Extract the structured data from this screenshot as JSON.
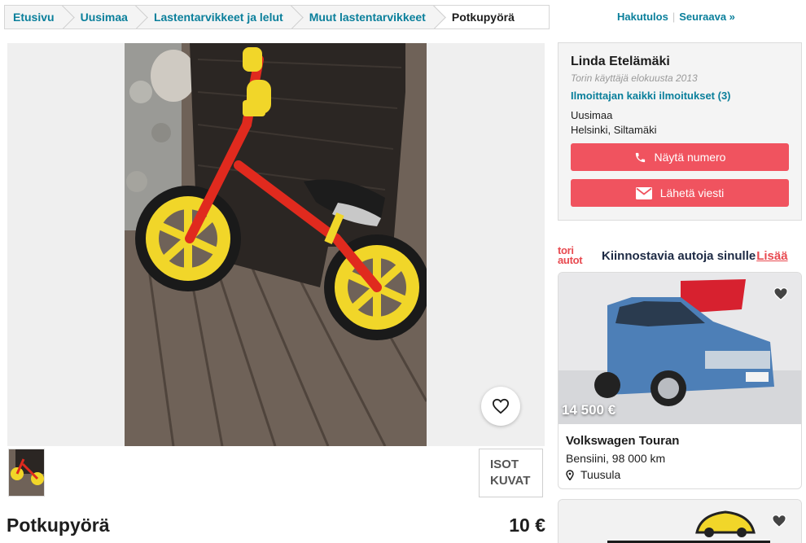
{
  "breadcrumb": {
    "items": [
      "Etusivu",
      "Uusimaa",
      "Lastentarvikkeet ja lelut",
      "Muut lastentarvikkeet"
    ],
    "current": "Potkupyörä"
  },
  "topnav": {
    "results": "Hakutulos",
    "next": "Seuraava »"
  },
  "gallery": {
    "fullsize_label_line1": "ISOT",
    "fullsize_label_line2": "KUVAT",
    "favorite_icon": "heart-outline-icon"
  },
  "listing": {
    "title": "Potkupyörä",
    "price": "10 €"
  },
  "seller": {
    "name": "Linda Etelämäki",
    "since": "Torin käyttäjä elokuusta 2013",
    "all_listings_link": "Ilmoittajan kaikki ilmoitukset (3)",
    "region": "Uusimaa",
    "city": "Helsinki, Siltamäki",
    "show_number": "Näytä numero",
    "send_message": "Lähetä viesti"
  },
  "promo": {
    "logo_line1": "tori",
    "logo_line2": "autot",
    "title": "Kiinnostavia autoja sinulle",
    "more": "Lisää",
    "cars": [
      {
        "price": "14 500 €",
        "name": "Volkswagen Touran",
        "specs": "Bensiini, 98 000 km",
        "location": "Tuusula"
      }
    ]
  },
  "colors": {
    "accent": "#0a7f9b",
    "button_red": "#f0535f",
    "tori_red": "#e84a50"
  }
}
